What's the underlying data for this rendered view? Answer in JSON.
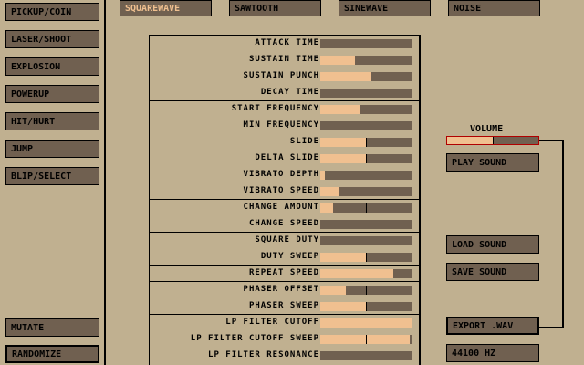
{
  "left_buttons": [
    {
      "label": "PICKUP/COIN"
    },
    {
      "label": "LASER/SHOOT"
    },
    {
      "label": "EXPLOSION"
    },
    {
      "label": "POWERUP"
    },
    {
      "label": "HIT/HURT"
    },
    {
      "label": "JUMP"
    },
    {
      "label": "BLIP/SELECT"
    }
  ],
  "mutate_label": "MUTATE",
  "randomize_label": "RANDOMIZE",
  "waveforms": [
    {
      "label": "SQUAREWAVE",
      "selected": true
    },
    {
      "label": "SAWTOOTH",
      "selected": false
    },
    {
      "label": "SINEWAVE",
      "selected": false
    },
    {
      "label": "NOISE",
      "selected": false
    }
  ],
  "sliders": [
    {
      "label": "ATTACK TIME",
      "value": 0.0
    },
    {
      "label": "SUSTAIN TIME",
      "value": 0.38
    },
    {
      "label": "SUSTAIN PUNCH",
      "value": 0.55
    },
    {
      "label": "DECAY TIME",
      "value": 0.0
    },
    {
      "label": "START FREQUENCY",
      "value": 0.44
    },
    {
      "label": "MIN FREQUENCY",
      "value": 0.0
    },
    {
      "label": "SLIDE",
      "value": 0.5,
      "center": true
    },
    {
      "label": "DELTA SLIDE",
      "value": 0.5,
      "center": true
    },
    {
      "label": "VIBRATO DEPTH",
      "value": 0.05
    },
    {
      "label": "VIBRATO SPEED",
      "value": 0.2
    },
    {
      "label": "CHANGE AMOUNT",
      "value": 0.14,
      "center": true
    },
    {
      "label": "CHANGE SPEED",
      "value": 0.0
    },
    {
      "label": "SQUARE DUTY",
      "value": 0.0
    },
    {
      "label": "DUTY SWEEP",
      "value": 0.5,
      "center": true
    },
    {
      "label": "REPEAT SPEED",
      "value": 0.79
    },
    {
      "label": "PHASER OFFSET",
      "value": 0.28,
      "center": true
    },
    {
      "label": "PHASER SWEEP",
      "value": 0.5,
      "center": true
    },
    {
      "label": "LP FILTER CUTOFF",
      "value": 1.0
    },
    {
      "label": "LP FILTER CUTOFF SWEEP",
      "value": 0.97,
      "center": true
    },
    {
      "label": "LP FILTER RESONANCE",
      "value": 0.0
    }
  ],
  "volume": {
    "label": "VOLUME",
    "value": 0.5
  },
  "play_label": "PLAY SOUND",
  "load_label": "LOAD SOUND",
  "save_label": "SAVE SOUND",
  "export_label": "EXPORT .WAV",
  "samplerate_label": "44100 HZ",
  "colors": {
    "bg": "#c0b090",
    "button": "#706050",
    "fill": "#f0c090",
    "highlight": "#b00000"
  }
}
